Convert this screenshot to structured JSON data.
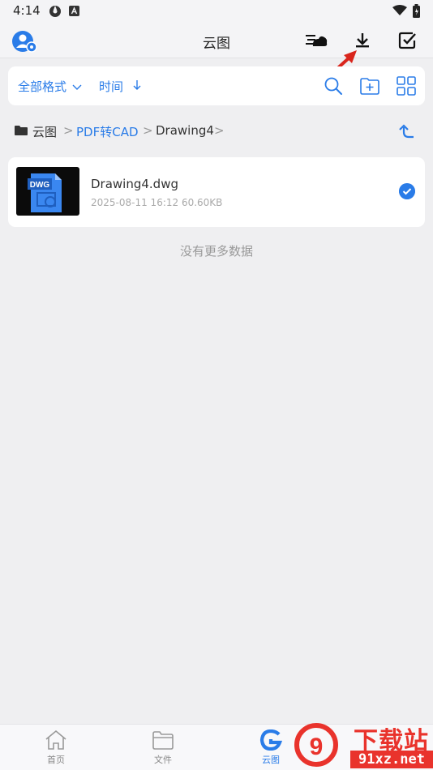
{
  "status_bar": {
    "time": "4:14"
  },
  "header": {
    "title": "云图"
  },
  "filter": {
    "format_label": "全部格式",
    "sort_label": "时间"
  },
  "breadcrumb": {
    "root": "云图",
    "folder": "PDF转CAD",
    "current": "Drawing4"
  },
  "file": {
    "thumb_label": "DWG",
    "name": "Drawing4.dwg",
    "meta": "2025-08-11 16:12  60.60KB",
    "selected": true
  },
  "list": {
    "empty_hint": "没有更多数据"
  },
  "nav": {
    "home": "首页",
    "files": "文件",
    "cloud": "云图"
  },
  "watermark": {
    "title": "下载站",
    "url": "91xz.net"
  },
  "colors": {
    "accent": "#2a7ce8",
    "background": "#efeff1",
    "watermark_red": "#e9332c"
  }
}
